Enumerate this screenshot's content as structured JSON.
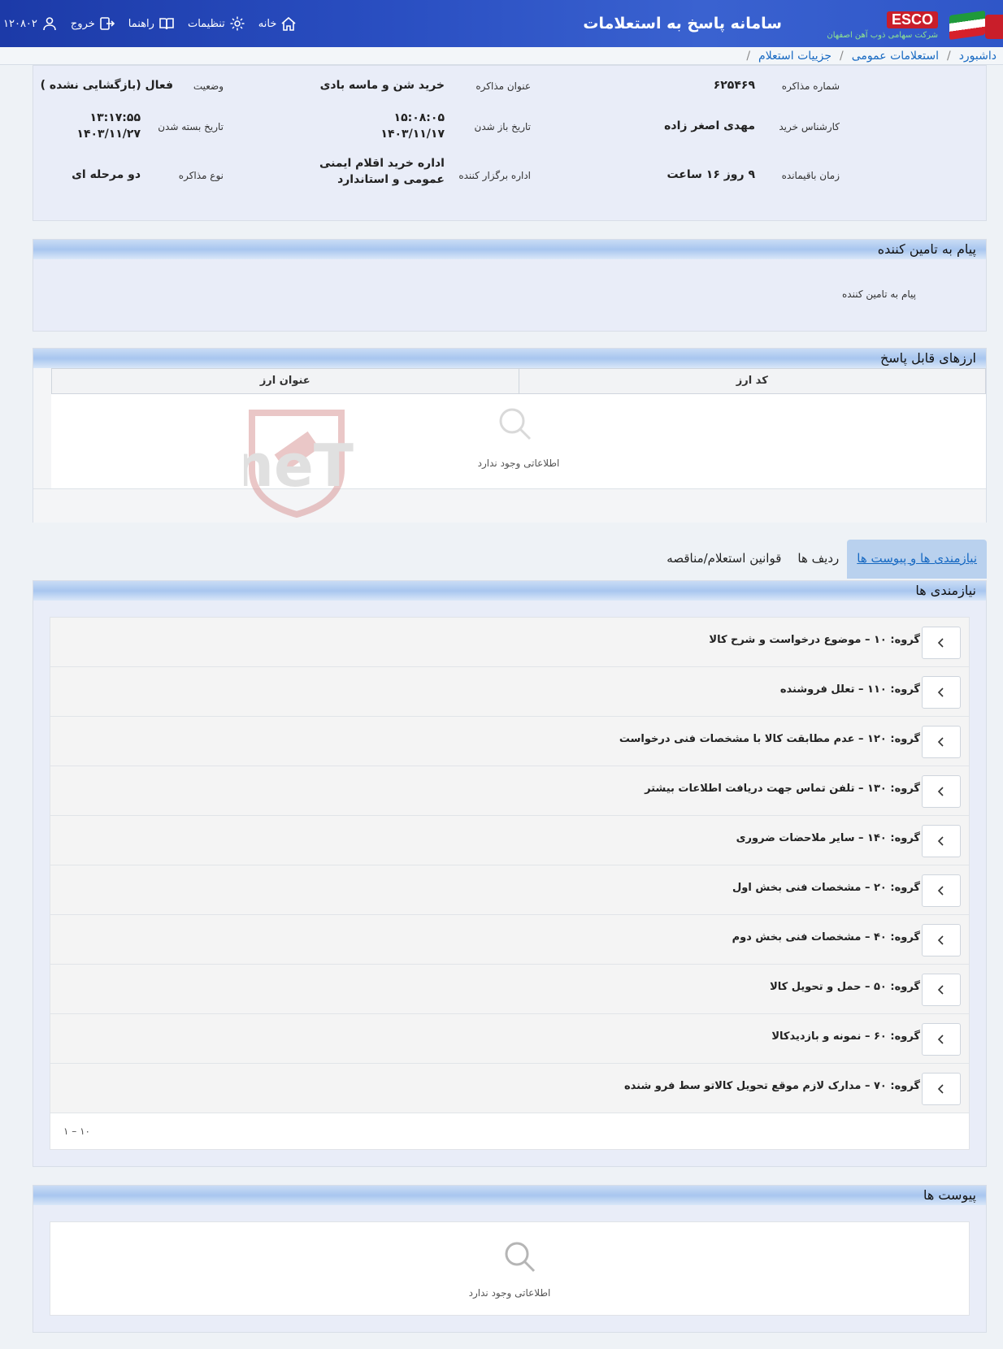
{
  "header": {
    "app_title": "سامانه پاسخ به استعلامات",
    "brand": "ESCO",
    "brand_sub": "شرکت سهامی ذوب آهن اصفهان",
    "nav": {
      "home": "خانه",
      "settings": "تنظیمات",
      "help": "راهنما",
      "logout": "خروج",
      "user_code": "۱۲۰۸۰۲"
    }
  },
  "breadcrumb": {
    "items": [
      "داشبورد",
      "استعلامات عمومی",
      "جزییات استعلام"
    ],
    "sep": "/"
  },
  "info": {
    "row1": {
      "number_label": "شماره مذاکره",
      "number_value": "۶۲۵۴۶۹",
      "title_label": "عنوان مذاکره",
      "title_value": "خرید شن و ماسه بادی",
      "status_label": "وضعیت",
      "status_value": "فعال (بازگشایی نشده )"
    },
    "row2": {
      "expert_label": "کارشناس خرید",
      "expert_value": "مهدی اصغر زاده",
      "open_label": "تاریخ باز شدن",
      "open_time": "۱۵:۰۸:۰۵",
      "open_date": "۱۴۰۳/۱۱/۱۷",
      "close_label": "تاریخ بسته شدن",
      "close_time": "۱۳:۱۷:۵۵",
      "close_date": "۱۴۰۳/۱۱/۲۷"
    },
    "row3": {
      "remain_label": "زمان باقیمانده",
      "remain_value": "۹ روز ۱۶ ساعت",
      "org_label": "اداره برگزار کننده",
      "org_value_1": "اداره خرید اقلام ایمنی",
      "org_value_2": "عمومی و استاندارد",
      "type_label": "نوع مذاکره",
      "type_value": "دو مرحله ای"
    }
  },
  "message": {
    "title": "پیام به تامین کننده",
    "text": "پیام به تامین کننده"
  },
  "currencies": {
    "title": "ارزهای قابل پاسخ",
    "columns": [
      "کد ارز",
      "عنوان ارز"
    ],
    "empty": "اطلاعاتی وجود ندارد"
  },
  "watermark": "AriaTender.neT",
  "tabs": [
    "نیازمندی ها و پیوست ها",
    "ردیف ها",
    "قوانین استعلام/مناقصه"
  ],
  "needs": {
    "title": "نیازمندی ها",
    "items": [
      "گروه: ۱۰ – موضوع درخواست و شرح کالا",
      "گروه: ۱۱۰ – تعلل فروشنده",
      "گروه: ۱۲۰ – عدم مطابقت کالا با مشخصات فنی درخواست",
      "گروه: ۱۳۰ – تلفن تماس جهت دریافت اطلاعات بیشتر",
      "گروه: ۱۴۰ – سایر ملاحضات ضروری",
      "گروه: ۲۰ – مشخصات فنی بخش اول",
      "گروه: ۴۰ – مشخصات فنی بخش دوم",
      "گروه: ۵۰ – حمل و تحویل کالا",
      "گروه: ۶۰ – نمونه و بازدیدکالا",
      "گروه: ۷۰ – مدارک لازم موقع تحویل کالاتو سط فرو شنده"
    ],
    "pager": "۱ – ۱۰"
  },
  "attachments": {
    "title": "پیوست ها",
    "empty": "اطلاعاتی وجود ندارد"
  },
  "colors": {
    "header": "#2a4fc2",
    "link": "#1769c2",
    "panel_bg": "#e9edf8",
    "tab_active": "#b9d1ee"
  }
}
